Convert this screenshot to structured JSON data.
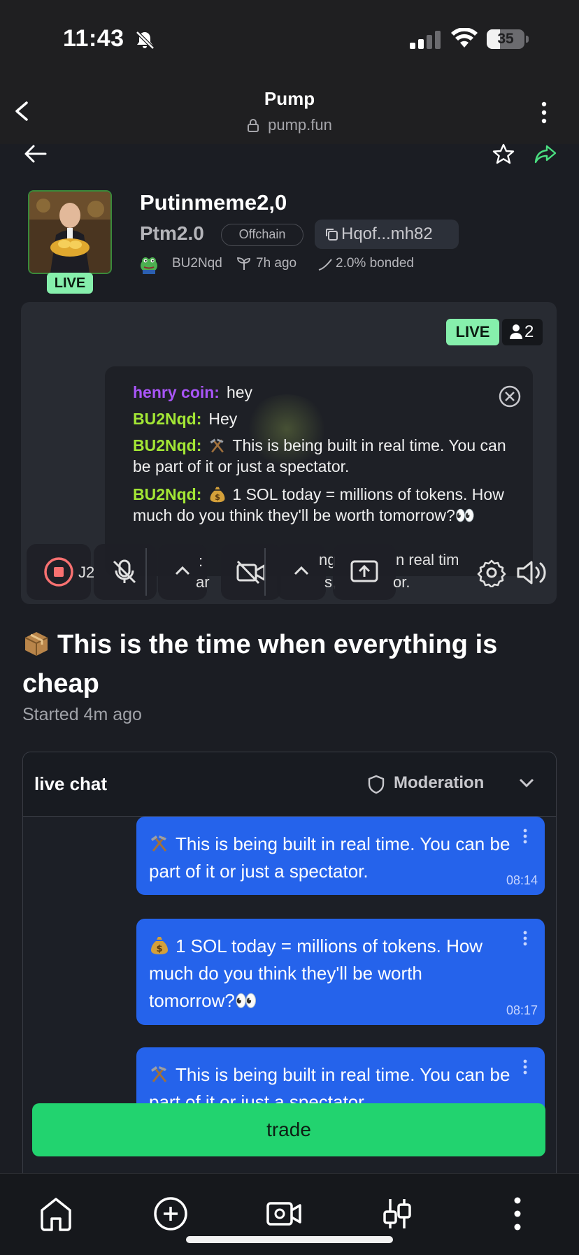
{
  "status_bar": {
    "time": "11:43",
    "battery": "35",
    "battery_level": 0.35
  },
  "browser": {
    "title": "Pump",
    "url": "pump.fun"
  },
  "token": {
    "name": "Putinmeme2,0",
    "ticker": "Ptm2.0",
    "tag": "Offchain",
    "address": "Hqof...mh82",
    "creator": "BU2Nqd",
    "age": "7h ago",
    "bonded": "2.0% bonded",
    "live_label": "LIVE"
  },
  "stream": {
    "live_label": "LIVE",
    "viewers": "2",
    "overlay_messages": [
      {
        "user": "henry coin:",
        "color": "#a855f7",
        "text": "hey"
      },
      {
        "user": "BU2Nqd:",
        "color": "#a3e635",
        "text": "Hey"
      },
      {
        "user": "BU2Nqd:",
        "color": "#a3e635",
        "emoji": "hammer-pick-icon",
        "text": "This is being built in real time. You can be part of it or just a spectator."
      },
      {
        "user": "BU2Nqd:",
        "color": "#a3e635",
        "emoji": "money-bag-icon",
        "text": "1 SOL today = millions of tokens. How much do you think they'll be worth tomorrow?👀"
      }
    ],
    "partial_text": {
      "left": "ar",
      "left_top": ":",
      "code": "J2",
      "mid_top": "ng",
      "mid_bottom": "s,",
      "right_top": "n real tim",
      "right_bottom": "or."
    }
  },
  "title": "This is the time when everything is cheap",
  "started": "Started 4m ago",
  "chat": {
    "title": "live chat",
    "moderation_label": "Moderation",
    "messages": [
      {
        "emoji": "hammer-pick-icon",
        "text": "This is being built in real time. You can be part of it or just a spectator.",
        "time": "08:14"
      },
      {
        "emoji": "money-bag-icon",
        "text": "1 SOL today = millions of tokens. How much do you think they'll be worth tomorrow?👀",
        "time": "08:17"
      },
      {
        "emoji": "hammer-pick-icon",
        "text": "This is being built in real time. You can be part of it or just a spectator.",
        "time": ""
      }
    ]
  },
  "trade_label": "trade",
  "nav": [
    "home-icon",
    "plus-circle-icon",
    "video-camera-icon",
    "candlestick-icon",
    "more-vertical-icon"
  ],
  "colors": {
    "accent_green": "#22d36f",
    "live_green": "#86efac",
    "message_blue": "#2563eb",
    "henry_purple": "#a855f7",
    "creator_lime": "#a3e635"
  }
}
